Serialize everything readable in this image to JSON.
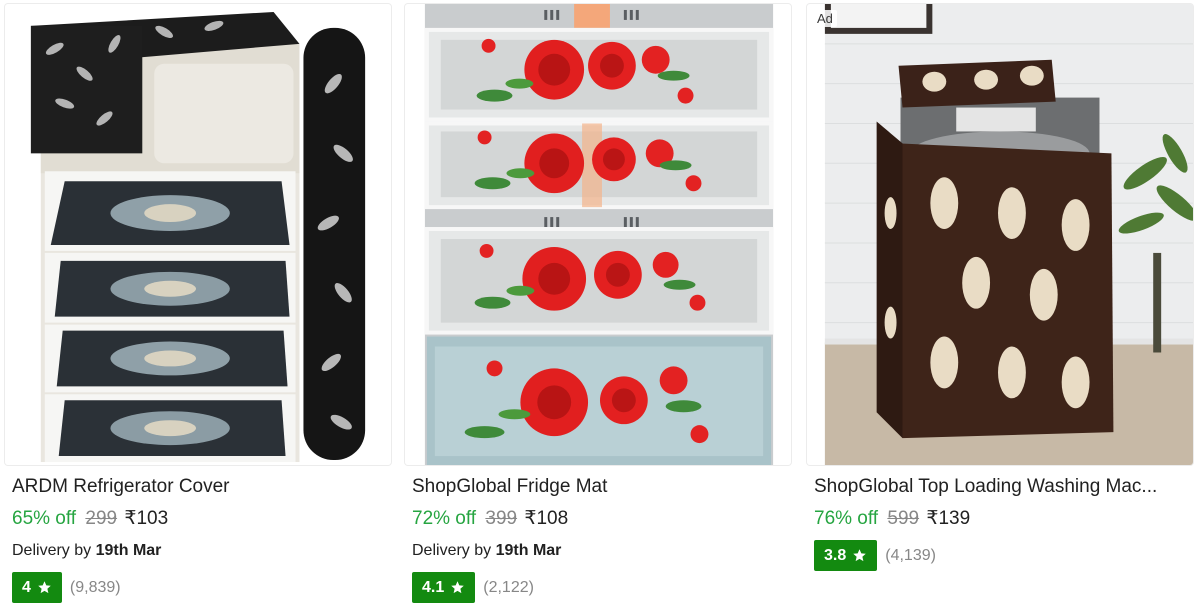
{
  "products": [
    {
      "title": "ARDM Refrigerator Cover",
      "discount": "65% off",
      "mrp": "299",
      "price": "₹103",
      "delivery_prefix": "Delivery by",
      "delivery_date": "19th Mar",
      "rating": "4",
      "rating_count": "(9,839)"
    },
    {
      "title": "ShopGlobal Fridge Mat",
      "discount": "72% off",
      "mrp": "399",
      "price": "₹108",
      "delivery_prefix": "Delivery by",
      "delivery_date": "19th Mar",
      "rating": "4.1",
      "rating_count": "(2,122)"
    },
    {
      "ad_label": "Ad",
      "title": "ShopGlobal Top Loading Washing Mac...",
      "discount": "76% off",
      "mrp": "599",
      "price": "₹139",
      "rating": "3.8",
      "rating_count": "(4,139)"
    }
  ],
  "colors": {
    "discount": "#26a541",
    "rating_badge": "#138a10",
    "muted": "#878787"
  },
  "icons": {
    "rating": "star-icon"
  }
}
